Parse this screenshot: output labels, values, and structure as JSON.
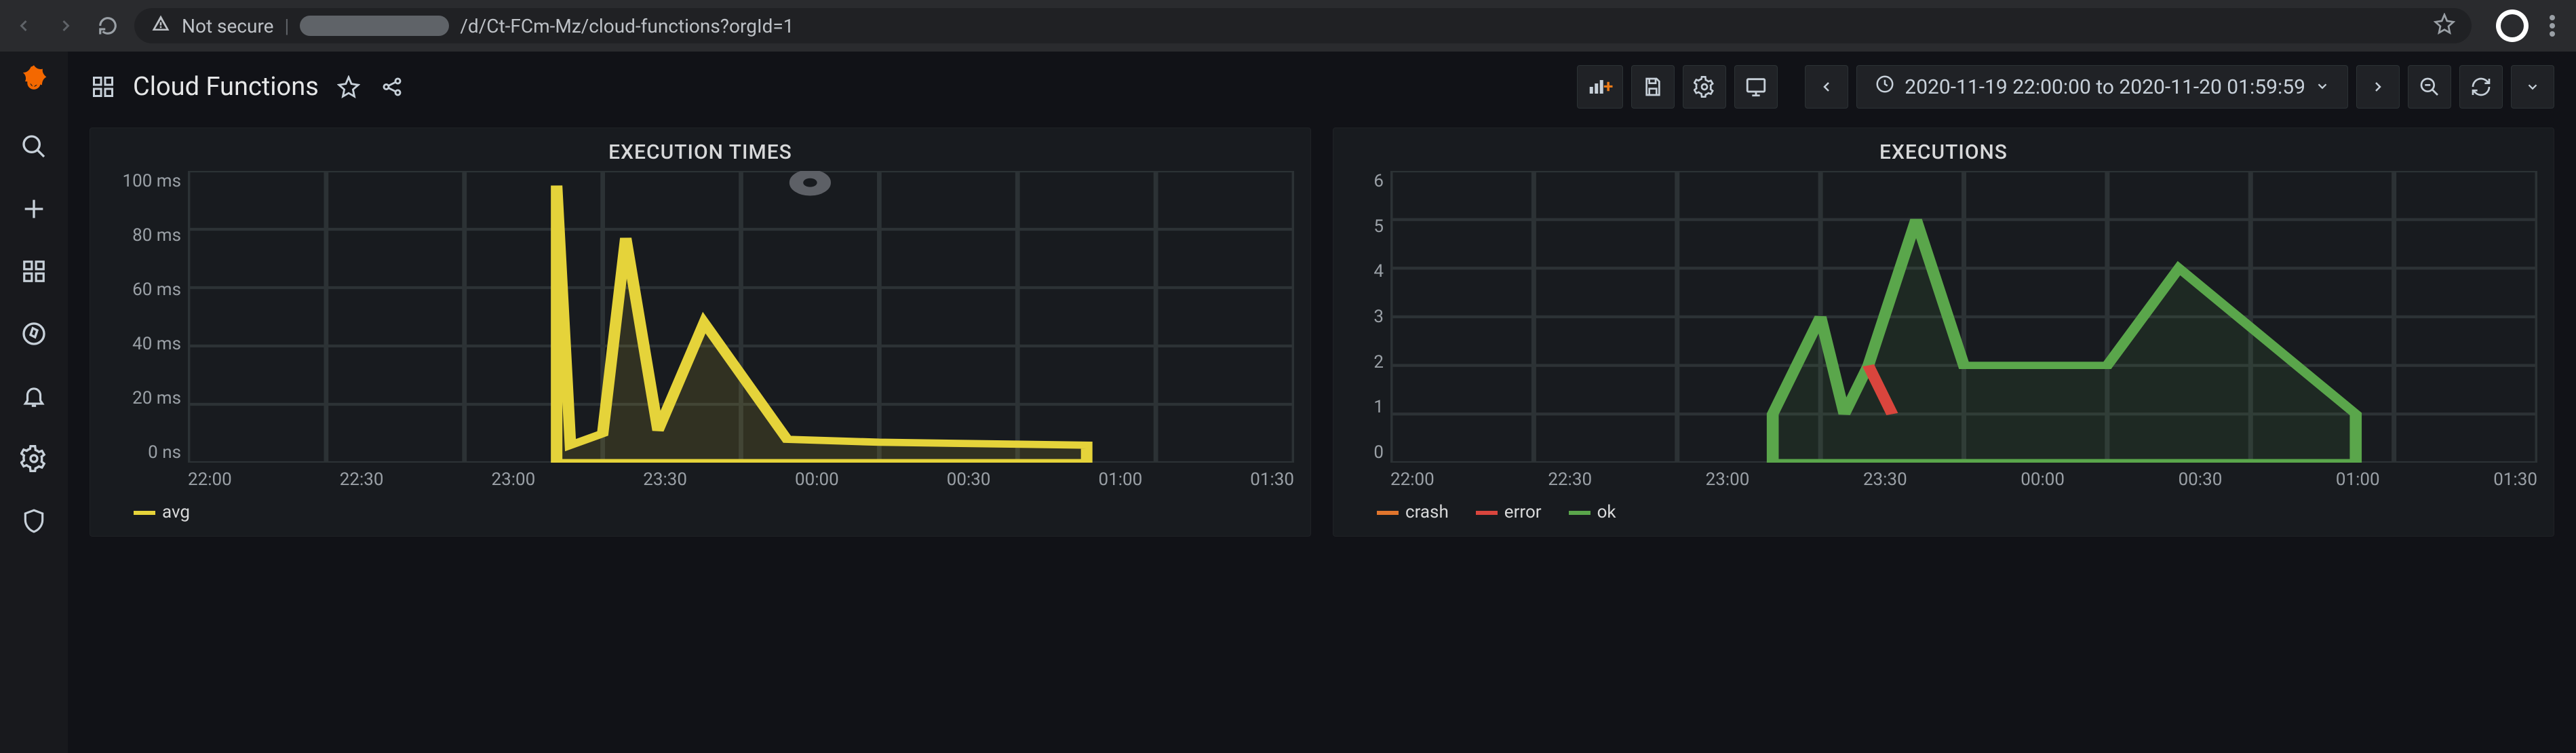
{
  "browser": {
    "not_secure": "Not secure",
    "url_tail": "/d/Ct-FCm-Mz/cloud-functions?orgId=1"
  },
  "header": {
    "title": "Cloud Functions",
    "time_range": "2020-11-19 22:00:00 to 2020-11-20 01:59:59"
  },
  "chart_data": [
    {
      "type": "area",
      "title": "EXECUTION TIMES",
      "ylabel": "",
      "y_ticks": [
        "100 ms",
        "80 ms",
        "60 ms",
        "40 ms",
        "20 ms",
        "0 ns"
      ],
      "ylim": [
        0,
        100
      ],
      "x_ticks": [
        "22:00",
        "22:30",
        "23:00",
        "23:30",
        "00:00",
        "00:30",
        "01:00",
        "01:30"
      ],
      "x_range_minutes": [
        0,
        240
      ],
      "series": [
        {
          "name": "avg",
          "color": "#e5d33a",
          "x_min": [
            80,
            83,
            90,
            95,
            102,
            112,
            130,
            150,
            195
          ],
          "y_ms": [
            95,
            6,
            10,
            77,
            11,
            48,
            8,
            7,
            6
          ]
        }
      ],
      "legend": [
        "avg"
      ]
    },
    {
      "type": "line",
      "title": "EXECUTIONS",
      "y_ticks": [
        "6",
        "5",
        "4",
        "3",
        "2",
        "1",
        "0"
      ],
      "ylim": [
        0,
        6
      ],
      "x_ticks": [
        "22:00",
        "22:30",
        "23:00",
        "23:30",
        "00:00",
        "00:30",
        "01:00",
        "01:30"
      ],
      "x_range_minutes": [
        0,
        240
      ],
      "series": [
        {
          "name": "crash",
          "color": "#e0752d",
          "x_min": [
            100,
            105
          ],
          "y": [
            2,
            1
          ]
        },
        {
          "name": "error",
          "color": "#d9453d",
          "x_min": [
            100,
            105
          ],
          "y": [
            2,
            1
          ]
        },
        {
          "name": "ok",
          "color": "#5aa64b",
          "x_min": [
            80,
            90,
            95,
            100,
            110,
            120,
            150,
            165,
            202
          ],
          "y": [
            1,
            3,
            1,
            2,
            5,
            2,
            2,
            4,
            1
          ]
        }
      ],
      "legend": [
        "crash",
        "error",
        "ok"
      ]
    }
  ]
}
